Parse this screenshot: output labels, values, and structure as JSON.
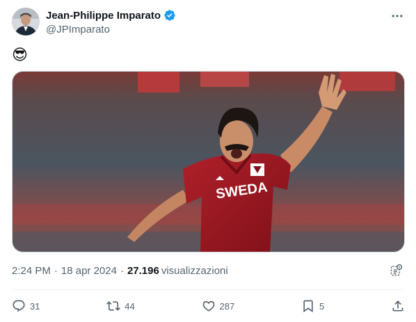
{
  "author": {
    "name": "Jean-Philippe Imparato",
    "handle": "@JPImparato",
    "verified": true
  },
  "tweet": {
    "text": "😎"
  },
  "media": {
    "jersey_text": "SWEDA"
  },
  "meta": {
    "time": "2:24 PM",
    "date": "18 apr 2024",
    "separator": "·",
    "views_count": "27.196",
    "views_label": "visualizzazioni"
  },
  "actions": {
    "replies": "31",
    "reposts": "44",
    "likes": "287",
    "bookmarks": "5"
  },
  "icons": {
    "more": "more-horizontal-icon",
    "verified": "verified-badge-icon",
    "analytics": "grok-analytics-icon",
    "reply": "reply-icon",
    "repost": "repost-icon",
    "like": "heart-icon",
    "bookmark": "bookmark-icon",
    "share": "share-icon"
  },
  "colors": {
    "verified": "#1d9bf0",
    "secondary_text": "#536471",
    "primary_text": "#0f1419"
  }
}
